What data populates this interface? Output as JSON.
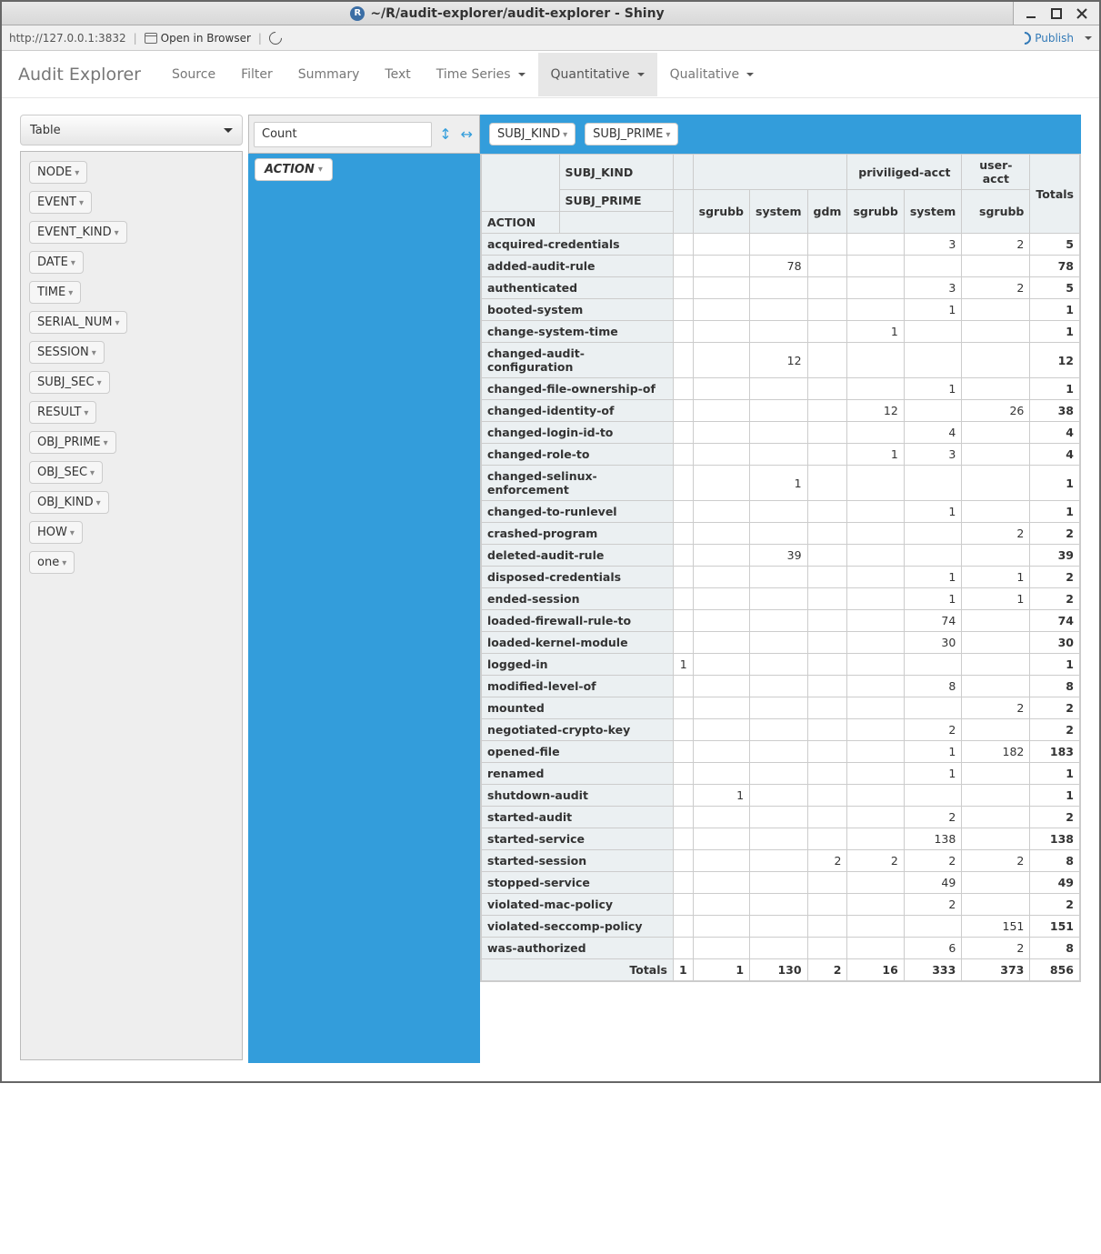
{
  "window": {
    "title": "~/R/audit-explorer/audit-explorer - Shiny"
  },
  "toolbar": {
    "url": "http://127.0.0.1:3832",
    "open_browser": "Open in Browser",
    "publish": "Publish"
  },
  "nav": {
    "brand": "Audit Explorer",
    "items": {
      "source": "Source",
      "filter": "Filter",
      "summary": "Summary",
      "text": "Text",
      "time": "Time Series",
      "quant": "Quantitative",
      "qual": "Qualitative"
    }
  },
  "controls": {
    "renderer": "Table",
    "aggregator": "Count"
  },
  "fields": {
    "unused": [
      "NODE",
      "EVENT",
      "EVENT_KIND",
      "DATE",
      "TIME",
      "SERIAL_NUM",
      "SESSION",
      "SUBJ_SEC",
      "RESULT",
      "OBJ_PRIME",
      "OBJ_SEC",
      "OBJ_KIND",
      "HOW",
      "one"
    ],
    "rows": [
      "ACTION"
    ],
    "cols": [
      "SUBJ_KIND",
      "SUBJ_PRIME"
    ]
  },
  "pivot": {
    "top_headers": {
      "kind_label": "SUBJ_KIND",
      "prime_label": "SUBJ_PRIME",
      "action_label": "ACTION",
      "totals_label": "Totals",
      "groups": [
        {
          "kind": "",
          "primes": [
            ""
          ]
        },
        {
          "kind": "",
          "primes": [
            "sgrubb",
            "system",
            "gdm"
          ]
        },
        {
          "kind": "priviliged-acct",
          "primes": [
            "sgrubb",
            "system"
          ]
        },
        {
          "kind": "user-acct",
          "primes": [
            "sgrubb"
          ]
        }
      ]
    },
    "rows": [
      {
        "label": "acquired-credentials",
        "cells": [
          "",
          "",
          "",
          "",
          "",
          "3",
          "2"
        ],
        "total": "5"
      },
      {
        "label": "added-audit-rule",
        "cells": [
          "",
          "",
          "78",
          "",
          "",
          "",
          ""
        ],
        "total": "78"
      },
      {
        "label": "authenticated",
        "cells": [
          "",
          "",
          "",
          "",
          "",
          "3",
          "2"
        ],
        "total": "5"
      },
      {
        "label": "booted-system",
        "cells": [
          "",
          "",
          "",
          "",
          "",
          "1",
          ""
        ],
        "total": "1"
      },
      {
        "label": "change-system-time",
        "cells": [
          "",
          "",
          "",
          "",
          "1",
          "",
          ""
        ],
        "total": "1"
      },
      {
        "label": "changed-audit-configuration",
        "cells": [
          "",
          "",
          "12",
          "",
          "",
          "",
          ""
        ],
        "total": "12"
      },
      {
        "label": "changed-file-ownership-of",
        "cells": [
          "",
          "",
          "",
          "",
          "",
          "1",
          ""
        ],
        "total": "1"
      },
      {
        "label": "changed-identity-of",
        "cells": [
          "",
          "",
          "",
          "",
          "12",
          "",
          "26"
        ],
        "total": "38"
      },
      {
        "label": "changed-login-id-to",
        "cells": [
          "",
          "",
          "",
          "",
          "",
          "4",
          ""
        ],
        "total": "4"
      },
      {
        "label": "changed-role-to",
        "cells": [
          "",
          "",
          "",
          "",
          "1",
          "3",
          ""
        ],
        "total": "4"
      },
      {
        "label": "changed-selinux-enforcement",
        "cells": [
          "",
          "",
          "1",
          "",
          "",
          "",
          ""
        ],
        "total": "1"
      },
      {
        "label": "changed-to-runlevel",
        "cells": [
          "",
          "",
          "",
          "",
          "",
          "1",
          ""
        ],
        "total": "1"
      },
      {
        "label": "crashed-program",
        "cells": [
          "",
          "",
          "",
          "",
          "",
          "",
          "2"
        ],
        "total": "2"
      },
      {
        "label": "deleted-audit-rule",
        "cells": [
          "",
          "",
          "39",
          "",
          "",
          "",
          ""
        ],
        "total": "39"
      },
      {
        "label": "disposed-credentials",
        "cells": [
          "",
          "",
          "",
          "",
          "",
          "1",
          "1"
        ],
        "total": "2"
      },
      {
        "label": "ended-session",
        "cells": [
          "",
          "",
          "",
          "",
          "",
          "1",
          "1"
        ],
        "total": "2"
      },
      {
        "label": "loaded-firewall-rule-to",
        "cells": [
          "",
          "",
          "",
          "",
          "",
          "74",
          ""
        ],
        "total": "74"
      },
      {
        "label": "loaded-kernel-module",
        "cells": [
          "",
          "",
          "",
          "",
          "",
          "30",
          ""
        ],
        "total": "30"
      },
      {
        "label": "logged-in",
        "cells": [
          "1",
          "",
          "",
          "",
          "",
          "",
          ""
        ],
        "total": "1"
      },
      {
        "label": "modified-level-of",
        "cells": [
          "",
          "",
          "",
          "",
          "",
          "8",
          ""
        ],
        "total": "8"
      },
      {
        "label": "mounted",
        "cells": [
          "",
          "",
          "",
          "",
          "",
          "",
          "2"
        ],
        "total": "2"
      },
      {
        "label": "negotiated-crypto-key",
        "cells": [
          "",
          "",
          "",
          "",
          "",
          "2",
          ""
        ],
        "total": "2"
      },
      {
        "label": "opened-file",
        "cells": [
          "",
          "",
          "",
          "",
          "",
          "1",
          "182"
        ],
        "total": "183"
      },
      {
        "label": "renamed",
        "cells": [
          "",
          "",
          "",
          "",
          "",
          "1",
          ""
        ],
        "total": "1"
      },
      {
        "label": "shutdown-audit",
        "cells": [
          "",
          "1",
          "",
          "",
          "",
          "",
          ""
        ],
        "total": "1"
      },
      {
        "label": "started-audit",
        "cells": [
          "",
          "",
          "",
          "",
          "",
          "2",
          ""
        ],
        "total": "2"
      },
      {
        "label": "started-service",
        "cells": [
          "",
          "",
          "",
          "",
          "",
          "138",
          ""
        ],
        "total": "138"
      },
      {
        "label": "started-session",
        "cells": [
          "",
          "",
          "",
          "2",
          "2",
          "2",
          "2"
        ],
        "total": "8"
      },
      {
        "label": "stopped-service",
        "cells": [
          "",
          "",
          "",
          "",
          "",
          "49",
          ""
        ],
        "total": "49"
      },
      {
        "label": "violated-mac-policy",
        "cells": [
          "",
          "",
          "",
          "",
          "",
          "2",
          ""
        ],
        "total": "2"
      },
      {
        "label": "violated-seccomp-policy",
        "cells": [
          "",
          "",
          "",
          "",
          "",
          "",
          "151"
        ],
        "total": "151"
      },
      {
        "label": "was-authorized",
        "cells": [
          "",
          "",
          "",
          "",
          "",
          "6",
          "2"
        ],
        "total": "8"
      }
    ],
    "totals": {
      "label": "Totals",
      "cells": [
        "1",
        "1",
        "130",
        "2",
        "16",
        "333",
        "373"
      ],
      "grand": "856"
    }
  }
}
